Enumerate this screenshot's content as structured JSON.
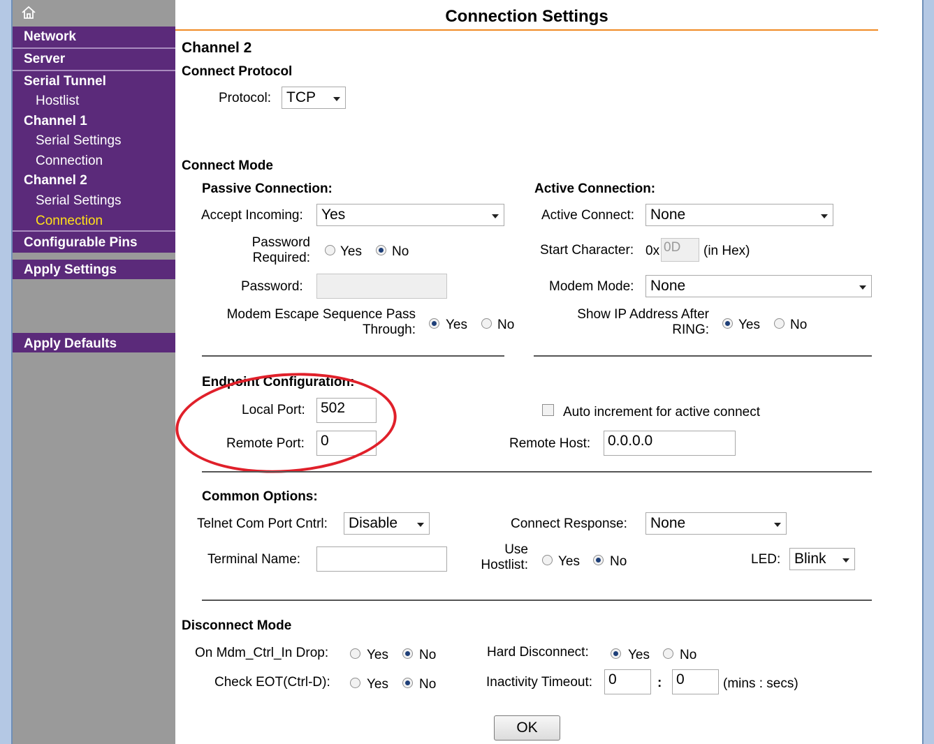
{
  "sidebar": {
    "home_icon": "home-icon",
    "items": [
      {
        "label": "Network"
      },
      {
        "label": "Server"
      },
      {
        "label": "Serial Tunnel"
      },
      {
        "label": "Hostlist"
      },
      {
        "label": "Channel 1"
      },
      {
        "label": "Serial Settings"
      },
      {
        "label": "Connection"
      },
      {
        "label": "Channel 2"
      },
      {
        "label": "Serial Settings"
      },
      {
        "label": "Connection"
      },
      {
        "label": "Configurable Pins"
      },
      {
        "label": "Apply Settings"
      },
      {
        "label": "Apply Defaults"
      }
    ],
    "colors": {
      "nav_bg": "#5b2a7a",
      "active": "#ffe11a",
      "sidebar_bg": "#9a9a9a"
    }
  },
  "header": {
    "title": "Connection Settings",
    "accent": "#f08a24"
  },
  "channel": "Channel 2",
  "protocol": {
    "heading": "Connect Protocol",
    "label": "Protocol:",
    "value": "TCP"
  },
  "connect_mode": {
    "heading": "Connect Mode",
    "passive": {
      "heading": "Passive Connection:",
      "accept_label": "Accept Incoming:",
      "accept_value": "Yes",
      "password_required_label_1": "Password",
      "password_required_label_2": "Required:",
      "password_label": "Password:",
      "password_value": "",
      "modem_escape_label_1": "Modem Escape Sequence Pass",
      "modem_escape_label_2": "Through:"
    },
    "active": {
      "heading": "Active Connection:",
      "active_connect_label": "Active Connect:",
      "active_connect_value": "None",
      "start_char_label": "Start Character:",
      "start_char_prefix": "0x",
      "start_char_value": "0D",
      "start_char_suffix": "(in Hex)",
      "modem_mode_label": "Modem Mode:",
      "modem_mode_value": "None",
      "show_ip_label_1": "Show IP Address After",
      "show_ip_label_2": "RING:"
    }
  },
  "endpoint": {
    "heading": "Endpoint Configuration:",
    "local_port_label": "Local Port:",
    "local_port_value": "502",
    "remote_port_label": "Remote Port:",
    "remote_port_value": "0",
    "auto_increment_label": "Auto increment for active connect",
    "remote_host_label": "Remote Host:",
    "remote_host_value": "0.0.0.0"
  },
  "common": {
    "heading": "Common Options:",
    "telnet_label": "Telnet Com Port Cntrl:",
    "telnet_value": "Disable",
    "connect_response_label": "Connect Response:",
    "connect_response_value": "None",
    "terminal_name_label": "Terminal Name:",
    "terminal_name_value": "",
    "use_hostlist_label_1": "Use",
    "use_hostlist_label_2": "Hostlist:",
    "led_label": "LED:",
    "led_value": "Blink"
  },
  "disconnect": {
    "heading": "Disconnect Mode",
    "mdm_label": "On Mdm_Ctrl_In Drop:",
    "hard_label": "Hard Disconnect:",
    "eot_label": "Check EOT(Ctrl-D):",
    "inactivity_label": "Inactivity Timeout:",
    "inactivity_mins": "0",
    "inactivity_sep": ":",
    "inactivity_secs": "0",
    "inactivity_units": "(mins : secs)"
  },
  "radio_labels": {
    "yes": "Yes",
    "no": "No"
  },
  "ok_label": "OK"
}
